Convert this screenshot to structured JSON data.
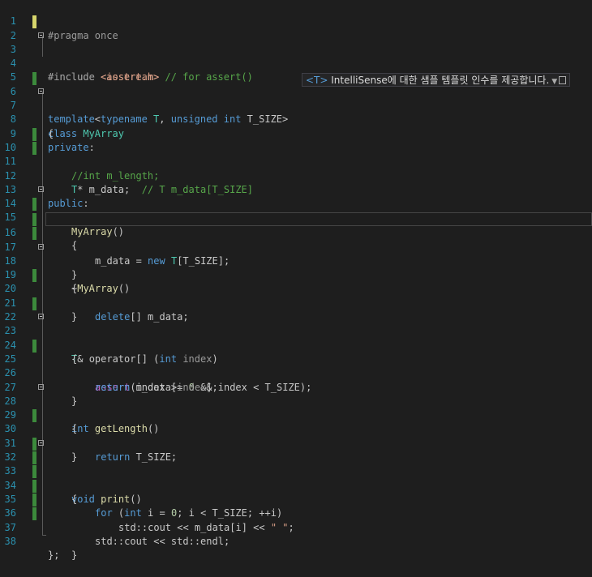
{
  "editor": {
    "line_numbers": [
      "1",
      "2",
      "3",
      "4",
      "5",
      "6",
      "7",
      "8",
      "9",
      "10",
      "11",
      "12",
      "13",
      "14",
      "15",
      "16",
      "17",
      "18",
      "19",
      "20",
      "21",
      "22",
      "23",
      "24",
      "25",
      "26",
      "27",
      "28",
      "29",
      "30",
      "31",
      "32",
      "33",
      "34",
      "35",
      "36",
      "37",
      "38"
    ],
    "lines": {
      "l1": {
        "p1": "#pragma once"
      },
      "l3": {
        "p1": "#include ",
        "p2": "<assert.h>",
        "p3": " // for assert()"
      },
      "l4": {
        "p1": "#include ",
        "p2": "<iostream>"
      },
      "l6": {
        "p1": "template",
        "p2": "<",
        "p3": "typename",
        "p4": " T",
        "p5": ", ",
        "p6": "unsigned",
        "p7": " ",
        "p8": "int",
        "p9": " T_SIZE>"
      },
      "l7": {
        "p1": "class",
        "p2": " ",
        "p3": "MyArray"
      },
      "l8": {
        "p1": "{"
      },
      "l9": {
        "p1": "private",
        "p2": ":"
      },
      "l10": {
        "p1": "//int m_length;"
      },
      "l11": {
        "p1": "T",
        "p2": "* m_data;  ",
        "p3": "// T m_data[T_SIZE]"
      },
      "l13": {
        "p1": "public",
        "p2": ":"
      },
      "l14": {
        "p1": "MyArray",
        "p2": "()"
      },
      "l15": {
        "p1": "{"
      },
      "l16": {
        "p1": "m_data = ",
        "p2": "new",
        "p3": " ",
        "p4": "T",
        "p5": "[T_SIZE];"
      },
      "l17": {
        "p1": "}"
      },
      "l18": {
        "p1": "~",
        "p2": "MyArray",
        "p3": "()"
      },
      "l19": {
        "p1": "{"
      },
      "l20": {
        "p1": "delete",
        "p2": "[] m_data;"
      },
      "l21": {
        "p1": "}"
      },
      "l23": {
        "p1": "T",
        "p2": "& ",
        "p3": "operator[]",
        "p4": " (",
        "p5": "int",
        "p6": " ",
        "p7": "index",
        "p8": ")"
      },
      "l24": {
        "p1": "{"
      },
      "l25": {
        "p1": "assert",
        "p2": "(index >= ",
        "p3": "0",
        "p4": " && index < T_SIZE);"
      },
      "l26": {
        "p1": "return",
        "p2": " m_data[",
        "p3": "index",
        "p4": "];"
      },
      "l27": {
        "p1": "}"
      },
      "l28": {
        "p1": "int",
        "p2": " ",
        "p3": "getLength",
        "p4": "()"
      },
      "l29": {
        "p1": "{"
      },
      "l30": {
        "p1": "return",
        "p2": " T_SIZE;"
      },
      "l31": {
        "p1": "}"
      },
      "l32": {
        "p1": "void",
        "p2": " ",
        "p3": "print",
        "p4": "()"
      },
      "l33": {
        "p1": "{"
      },
      "l34": {
        "p1": "for",
        "p2": " (",
        "p3": "int",
        "p4": " i = ",
        "p5": "0",
        "p6": "; i < T_SIZE; ++i)"
      },
      "l35": {
        "p1": "std::cout << m_data[i] << ",
        "p2": "\" \"",
        "p3": ";"
      },
      "l36": {
        "p1": "std::cout << std::endl;"
      },
      "l37": {
        "p1": "}"
      },
      "l38": {
        "p1": "};"
      }
    }
  },
  "intellisense_hint": {
    "tag": "<T>",
    "text": " IntelliSense에 대한 샘플 템플릿 인수를 제공합니다."
  },
  "icons": {
    "hint_dropdown": "chevron-down-icon",
    "hint_box": "window-icon",
    "fold": "collapse-minus-icon"
  },
  "colors": {
    "background": "#1e1e1e",
    "line_number": "#2b91af",
    "keyword": "#569cd6",
    "comment": "#57a64a",
    "string": "#d69d85",
    "type": "#4ec9b0",
    "function": "#dcdcaa",
    "number": "#b5cea8",
    "saved_change": "#3c8a3c",
    "unsaved_change": "#d7d56c"
  }
}
